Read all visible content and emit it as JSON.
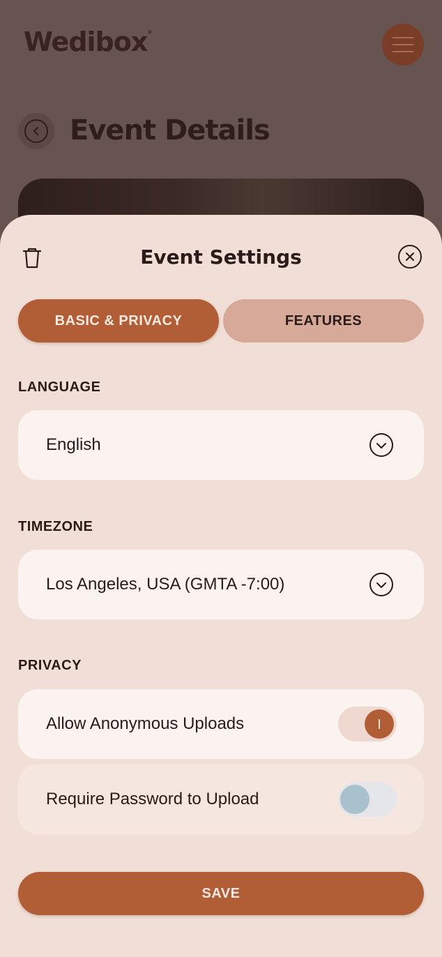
{
  "app": {
    "logo_text": "Wedibox",
    "logo_mark": "*",
    "page_title": "Event Details"
  },
  "sheet": {
    "title": "Event Settings",
    "tabs": [
      {
        "label": "BASIC & PRIVACY",
        "active": true
      },
      {
        "label": "FEATURES",
        "active": false
      }
    ],
    "language": {
      "label": "LANGUAGE",
      "value": "English"
    },
    "timezone": {
      "label": "TIMEZONE",
      "value": "Los Angeles, USA (GMTA -7:00)"
    },
    "privacy": {
      "label": "PRIVACY",
      "options": [
        {
          "label": "Allow Anonymous Uploads",
          "enabled": true
        },
        {
          "label": "Require Password to Upload",
          "enabled": false
        }
      ]
    },
    "save_label": "SAVE"
  },
  "icons": {
    "menu": "hamburger-icon",
    "back": "chevron-left-icon",
    "delete": "trash-icon",
    "close": "close-icon",
    "dropdown": "chevron-down-icon"
  },
  "colors": {
    "accent": "#b15e36",
    "sheet_bg": "#f1dfd7",
    "overlay": "#675350"
  }
}
